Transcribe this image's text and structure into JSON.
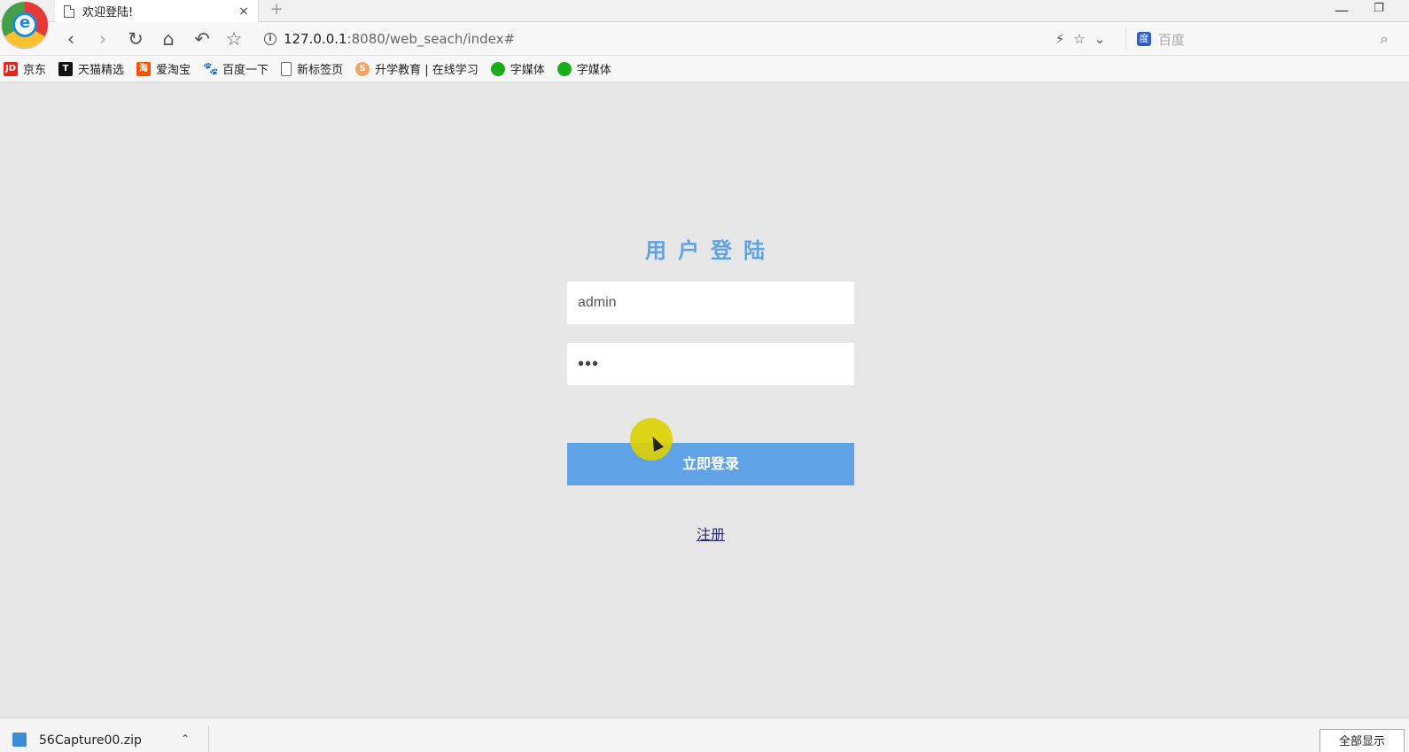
{
  "browser": {
    "tab_title": "欢迎登陆!",
    "tab_close": "×",
    "new_tab": "+",
    "url_host": "127.0.0.1",
    "url_path": ":8080/web_seach/index#",
    "search_placeholder": "百度",
    "window_min": "—",
    "window_restore": "❐",
    "logo_letter": "e"
  },
  "bookmarks": [
    {
      "label": "京东",
      "icon": "JD"
    },
    {
      "label": "天猫精选",
      "icon": "T"
    },
    {
      "label": "爱淘宝",
      "icon": "淘"
    },
    {
      "label": "百度一下",
      "icon": "🐾"
    },
    {
      "label": "新标签页",
      "icon": ""
    },
    {
      "label": "升学教育 | 在线学习",
      "icon": "S"
    },
    {
      "label": "字媒体",
      "icon": ""
    },
    {
      "label": "字媒体",
      "icon": ""
    }
  ],
  "login": {
    "title": "用户登陆",
    "username_value": "admin",
    "password_value": "•••",
    "submit_label": "立即登录",
    "register_label": "注册"
  },
  "download": {
    "filename": "56Capture00.zip",
    "show_all": "全部显示"
  },
  "colors": {
    "accent": "#5fa2e5",
    "page_bg": "#e6e6e6"
  }
}
